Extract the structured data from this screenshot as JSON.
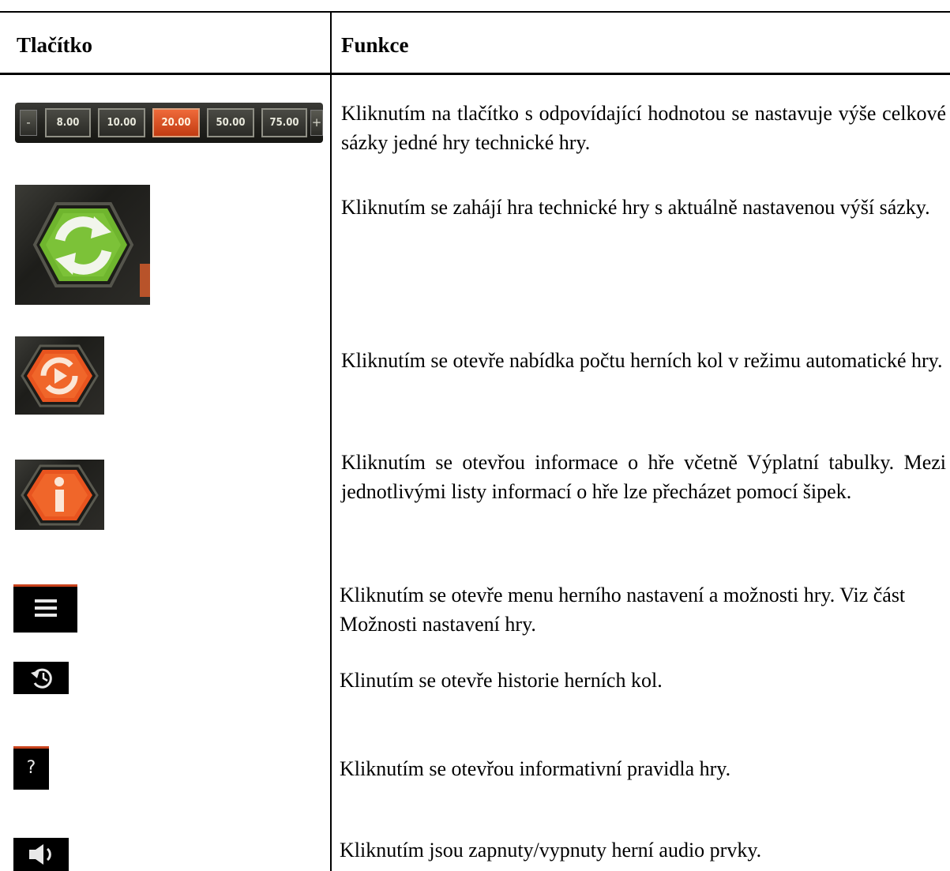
{
  "table": {
    "header": {
      "button": "Tlačítko",
      "function": "Funkce"
    },
    "bet_bar": {
      "minus": "-",
      "plus": "+",
      "values": [
        "8.00",
        "10.00",
        "20.00",
        "50.00",
        "75.00"
      ],
      "selected": "20.00"
    },
    "rows": [
      {
        "icon": "bet-selector-icon",
        "description": "Kliknutím na tlačítko s odpovídající hodnotou se nastavuje výše celkové sázky jedné hry technické hry."
      },
      {
        "icon": "spin-icon",
        "description": "Kliknutím se zahájí hra technické hry s aktuálně nastavenou výší sázky."
      },
      {
        "icon": "autoplay-icon",
        "description": "Kliknutím se otevře nabídka počtu herních kol v režimu automatické hry."
      },
      {
        "icon": "info-icon",
        "description": "Kliknutím se otevřou informace o hře včetně Výplatní tabulky. Mezi jednotlivými listy informací o hře lze přecházet pomocí šipek."
      },
      {
        "icon": "menu-icon",
        "description": "Kliknutím se otevře menu herního nastavení a možnosti hry. Viz část Možnosti nastavení hry."
      },
      {
        "icon": "history-icon",
        "description": "Klinutím se otevře historie herních kol."
      },
      {
        "icon": "help-icon",
        "label": "?",
        "description": "Kliknutím se otevřou informativní pravidla hry."
      },
      {
        "icon": "sound-icon",
        "description": "Kliknutím jsou zapnuty/vypnuty herní audio prvky."
      }
    ]
  }
}
